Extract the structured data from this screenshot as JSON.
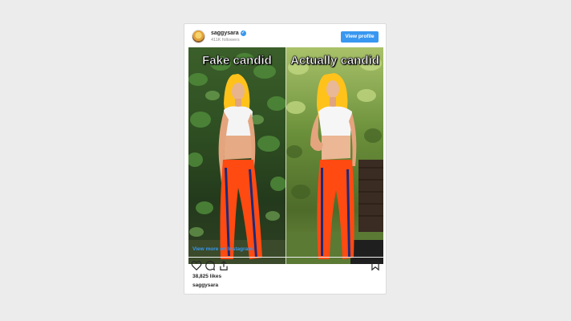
{
  "post": {
    "username": "saggysara",
    "verified_mark": "✓",
    "followers": "411K followers",
    "view_profile_label": "View profile",
    "caption_left": "Fake candid",
    "caption_right": "Actually candid",
    "view_more_label": "View more on Instagram",
    "likes": "38,825 likes",
    "caption_user": "saggysara"
  },
  "icons": {
    "heart": "heart-icon",
    "comment": "comment-icon",
    "share": "share-icon",
    "bookmark": "bookmark-icon"
  },
  "colors": {
    "accent": "#3897f0",
    "background": "#ececec",
    "pants": "#ff4a12",
    "hair": "#ffc21a"
  }
}
